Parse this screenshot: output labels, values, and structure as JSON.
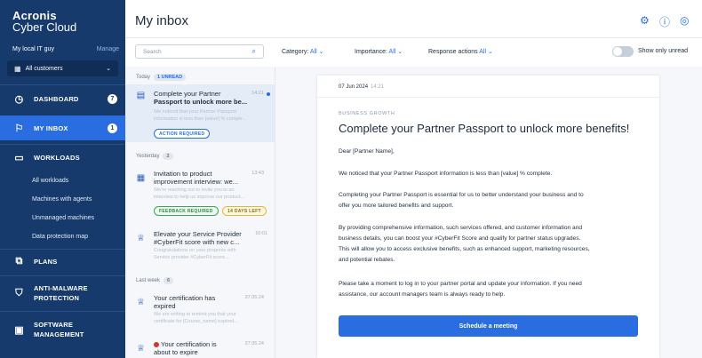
{
  "brand": {
    "line1": "Acronis",
    "line2": "Cyber Cloud"
  },
  "account": {
    "name": "My local IT guy",
    "manage_label": "Manage",
    "customer_select": "All customers"
  },
  "nav": {
    "dashboard": {
      "label": "DASHBOARD",
      "badge": "7"
    },
    "inbox": {
      "label": "MY INBOX",
      "badge": "1"
    },
    "workloads": {
      "label": "WORKLOADS"
    },
    "workload_sub": [
      "All workloads",
      "Machines with agents",
      "Unmanaged machines",
      "Data protection map"
    ],
    "plans": {
      "label": "PLANS"
    },
    "antimalware": {
      "line1": "ANTI-MALWARE",
      "line2": "PROTECTION"
    },
    "software": {
      "line1": "SOFTWARE",
      "line2": "MANAGEMENT"
    }
  },
  "header": {
    "title": "My inbox",
    "icons": [
      "gear-icon",
      "help-icon",
      "user-icon"
    ]
  },
  "filters": {
    "search_placeholder": "Search",
    "category": {
      "label": "Category:",
      "value": "All"
    },
    "importance": {
      "label": "Importance:",
      "value": "All"
    },
    "response": {
      "label": "Response actions",
      "value": "All"
    },
    "toggle_label": "Show only unread"
  },
  "groups": {
    "today": {
      "label": "Today",
      "badge": "1 UNREAD"
    },
    "yesterday": {
      "label": "Yesterday",
      "badge": "2"
    },
    "lastweek": {
      "label": "Last week",
      "badge": "6"
    }
  },
  "messages": [
    {
      "line1": "Complete your Partner",
      "line2": "Passport to unlock more be...",
      "time": "14:21",
      "prev1": "We noticed that your Partner Passport",
      "prev2": "information is less than [value] % comple...",
      "tags": [
        "ACTION REQUIRED"
      ]
    },
    {
      "line1": "Invitation to product",
      "line2": "improvement interview: we...",
      "time": "13:43",
      "prev1": "We're reaching out to invite you to an",
      "prev2": "interview to help us improve our product...",
      "tags": [
        "FEEDBACK REQUIRED",
        "14 DAYS LEFT"
      ]
    },
    {
      "line1": "Elevate your Service Provider",
      "line2": "#CyberFit score with new c...",
      "time": "10:01",
      "prev1": "Congratulations on your progress with",
      "prev2": "Service provider #CyberFit score..."
    },
    {
      "line1": "Your certification has",
      "line2": "expired",
      "time": "27.05.24",
      "prev1": "We are writing to remind you that your",
      "prev2": "certificate for [Course_name] expired..."
    },
    {
      "line1": "Your certification is",
      "line2": "about to expire",
      "time": "27.05.24"
    }
  ],
  "detail": {
    "date": "07 Jun 2024",
    "time": "14:21",
    "category": "BUSINESS GROWTH",
    "title": "Complete your Partner Passport to unlock more benefits!",
    "greeting": "Dear [Partner Name],",
    "p1": "We noticed that your Partner Passport information is less than [value] % complete.",
    "p2a": "Completing your Partner Passport is essential for us to better understand your business and to",
    "p2b": "offer you more tailored benefits and support.",
    "p3a": "By providing comprehensive information, such services offered, and customer information and",
    "p3b": "business details, you can boost your #CyberFit Score and qualify for partner status upgrades.",
    "p3c": "This will allow you to access exclusive benefits, such as enhanced support, marketing resources,",
    "p3d": "and potential rebates.",
    "p4a": "Please take a moment to log in to your partner portal and update your information. If you need",
    "p4b": "assistance, our account managers team is always ready to help.",
    "cta": "Schedule a meeting"
  }
}
